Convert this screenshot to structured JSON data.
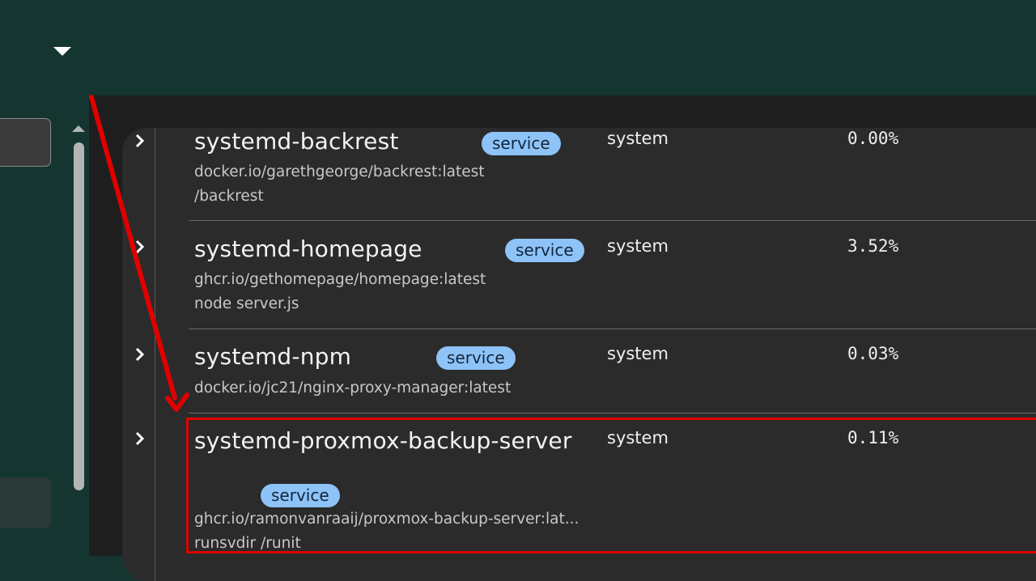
{
  "colors": {
    "header_bg": "#153630",
    "panel_bg": "#1e1e1e",
    "card_bg": "#2b2b2b",
    "badge_bg": "#8ec3f8",
    "badge_text": "#13253b",
    "annotation_red": "#e00000"
  },
  "header": {
    "dropdown_icon": "caret-down-icon"
  },
  "containers": [
    {
      "name": "systemd-backrest",
      "badge": "service",
      "image": "docker.io/garethgeorge/backrest:latest",
      "command": "/backrest",
      "owner": "system",
      "cpu": "0.00%"
    },
    {
      "name": "systemd-homepage",
      "badge": "service",
      "image": "ghcr.io/gethomepage/homepage:latest",
      "command": "node server.js",
      "owner": "system",
      "cpu": "3.52%"
    },
    {
      "name": "systemd-npm",
      "badge": "service",
      "image": "docker.io/jc21/nginx-proxy-manager:latest",
      "command": "",
      "owner": "system",
      "cpu": "0.03%"
    },
    {
      "name": "systemd-proxmox-backup-server",
      "badge": "service",
      "image": "ghcr.io/ramonvanraaij/proxmox-backup-server:lat...",
      "command": "runsvdir /runit",
      "owner": "system",
      "cpu": "0.11%"
    }
  ]
}
